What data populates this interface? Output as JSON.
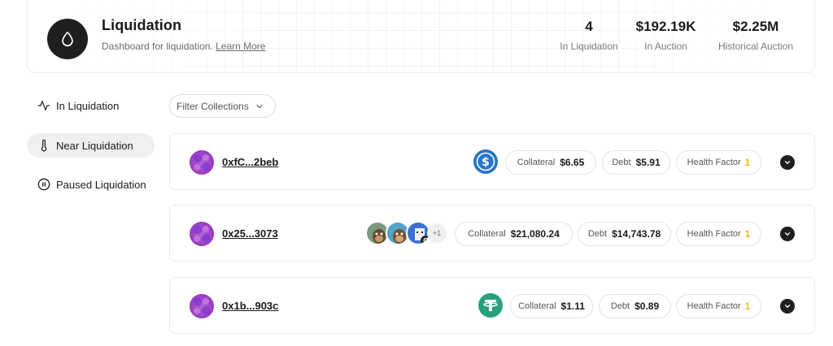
{
  "header": {
    "title": "Liquidation",
    "subtitle": "Dashboard for liquidation.",
    "learn_more": "Learn More",
    "stats": [
      {
        "value": "4",
        "label": "In Liquidation"
      },
      {
        "value": "$192.19K",
        "label": "In Auction"
      },
      {
        "value": "$2.25M",
        "label": "Historical Auction"
      }
    ]
  },
  "sidebar": {
    "items": [
      {
        "label": "In Liquidation",
        "icon": "activity-icon",
        "active": false
      },
      {
        "label": "Near Liquidation",
        "icon": "thermometer-icon",
        "active": true
      },
      {
        "label": "Paused Liquidation",
        "icon": "pause-circle-icon",
        "active": false
      }
    ]
  },
  "filter": {
    "label": "Filter Collections"
  },
  "labels": {
    "collateral": "Collateral",
    "debt": "Debt",
    "health_factor": "Health Factor"
  },
  "rows": [
    {
      "address": "0xfC...2beb",
      "assets": [
        "usdc-icon"
      ],
      "collateral": "$6.65",
      "debt": "$5.91",
      "health_factor": "1"
    },
    {
      "address": "0x25...3073",
      "assets": [
        "ape-nft-icon",
        "ape-nft-icon",
        "cryptopunk-nft-icon"
      ],
      "more": "+1",
      "collateral": "$21,080.24",
      "debt": "$14,743.78",
      "health_factor": "1"
    },
    {
      "address": "0x1b...903c",
      "assets": [
        "tether-icon"
      ],
      "collateral": "$1.11",
      "debt": "$0.89",
      "health_factor": "1"
    }
  ],
  "colors": {
    "accent_dark": "#1f1f1f",
    "health_factor": "#f0b90b",
    "usdc": "#2775ca",
    "tether": "#26a17b",
    "avatar": "#9a3fc4"
  }
}
